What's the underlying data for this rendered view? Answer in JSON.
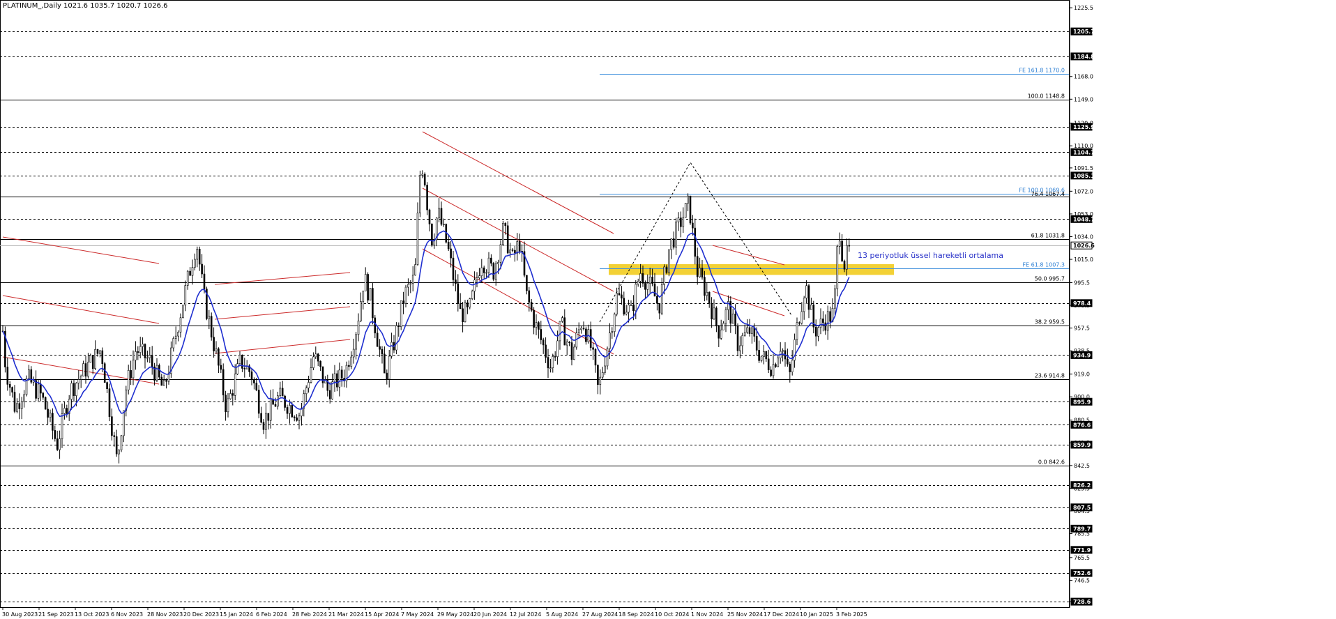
{
  "chart_data": {
    "type": "candlestick",
    "symbol_info": "PLATINUM_,Daily  1021.6 1035.7 1020.7 1026.6",
    "ylim": [
      724.0,
      1232.0
    ],
    "price_axis_ticks": [
      1225.5,
      1168.0,
      1149.0,
      1129.0,
      1110.0,
      1091.5,
      1072.0,
      1053.0,
      1034.0,
      1015.0,
      995.5,
      976.5,
      957.5,
      938.5,
      919.0,
      900.0,
      880.5,
      861.5,
      842.5,
      823.5,
      804.5,
      785.5,
      765.5,
      746.5,
      728.6
    ],
    "price_level_boxes": [
      1205.7,
      1184.8,
      1125.9,
      1104.7,
      1085.1,
      1048.7,
      1026.6,
      978.4,
      934.9,
      895.9,
      876.6,
      859.9,
      826.2,
      807.5,
      789.7,
      771.9,
      752.6,
      728.6
    ],
    "x_date_labels": [
      "30 Aug 2023",
      "21 Sep 2023",
      "13 Oct 2023",
      "6 Nov 2023",
      "28 Nov 2023",
      "20 Dec 2023",
      "15 Jan 2024",
      "6 Feb 2024",
      "28 Feb 2024",
      "21 Mar 2024",
      "15 Apr 2024",
      "7 May 2024",
      "29 May 2024",
      "20 Jun 2024",
      "12 Jul 2024",
      "5 Aug 2024",
      "27 Aug 2024",
      "18 Sep 2024",
      "10 Oct 2024",
      "1 Nov 2024",
      "25 Nov 2024",
      "17 Dec 2024",
      "10 Jan 2025",
      "3 Feb 2025"
    ],
    "fibonacci_levels": [
      {
        "label": "100.0 1148.8",
        "value": 1148.8
      },
      {
        "label": "61.8 1031.8",
        "value": 1031.8
      },
      {
        "label": "50.0 995.7",
        "value": 995.7
      },
      {
        "label": "38.2 959.5",
        "value": 959.5
      },
      {
        "label": "23.6 914.8",
        "value": 914.8
      },
      {
        "label": "0.0 842.6",
        "value": 842.6
      }
    ],
    "fibonacci_expansion": [
      {
        "label": "FE 161.8 1170.0",
        "value": 1170.0
      },
      {
        "label": "FE 100.0 1069.6",
        "value": 1069.6
      },
      {
        "label": "FE 61.8 1007.3",
        "value": 1007.3
      }
    ],
    "overlap_label": "76.4 1067.4",
    "annotation": "13 periyotluk üssel hareketli ortalama",
    "ema_period": 13,
    "last_price": 1026.6,
    "anchors": [
      [
        0,
        985
      ],
      [
        8,
        925
      ],
      [
        22,
        890
      ],
      [
        40,
        915
      ],
      [
        60,
        900
      ],
      [
        82,
        860
      ],
      [
        100,
        905
      ],
      [
        125,
        925
      ],
      [
        145,
        940
      ],
      [
        168,
        845
      ],
      [
        180,
        905
      ],
      [
        195,
        940
      ],
      [
        215,
        930
      ],
      [
        235,
        905
      ],
      [
        255,
        960
      ],
      [
        270,
        1000
      ],
      [
        282,
        1030
      ],
      [
        292,
        985
      ],
      [
        310,
        935
      ],
      [
        325,
        890
      ],
      [
        345,
        930
      ],
      [
        360,
        920
      ],
      [
        378,
        880
      ],
      [
        400,
        900
      ],
      [
        430,
        885
      ],
      [
        450,
        935
      ],
      [
        470,
        905
      ],
      [
        495,
        920
      ],
      [
        512,
        960
      ],
      [
        522,
        1000
      ],
      [
        530,
        985
      ],
      [
        552,
        915
      ],
      [
        565,
        945
      ],
      [
        580,
        985
      ],
      [
        595,
        1000
      ],
      [
        602,
        1085
      ],
      [
        607,
        1095
      ],
      [
        612,
        1065
      ],
      [
        620,
        1030
      ],
      [
        628,
        1055
      ],
      [
        642,
        1025
      ],
      [
        660,
        970
      ],
      [
        672,
        970
      ],
      [
        690,
        1015
      ],
      [
        708,
        1005
      ],
      [
        722,
        1040
      ],
      [
        735,
        1015
      ],
      [
        745,
        1030
      ],
      [
        755,
        985
      ],
      [
        768,
        960
      ],
      [
        790,
        925
      ],
      [
        805,
        960
      ],
      [
        820,
        935
      ],
      [
        835,
        965
      ],
      [
        848,
        940
      ],
      [
        858,
        905
      ],
      [
        870,
        940
      ],
      [
        885,
        985
      ],
      [
        905,
        970
      ],
      [
        918,
        1005
      ],
      [
        935,
        990
      ],
      [
        945,
        975
      ],
      [
        960,
        1025
      ],
      [
        975,
        1045
      ],
      [
        988,
        1062
      ],
      [
        1000,
        1005
      ],
      [
        1015,
        985
      ],
      [
        1030,
        955
      ],
      [
        1045,
        975
      ],
      [
        1058,
        945
      ],
      [
        1075,
        955
      ],
      [
        1090,
        935
      ],
      [
        1108,
        925
      ],
      [
        1120,
        945
      ],
      [
        1132,
        915
      ],
      [
        1145,
        965
      ],
      [
        1155,
        995
      ],
      [
        1168,
        955
      ],
      [
        1185,
        965
      ],
      [
        1196,
        970
      ],
      [
        1203,
        1045
      ],
      [
        1210,
        1010
      ],
      [
        1220,
        1028
      ]
    ]
  }
}
